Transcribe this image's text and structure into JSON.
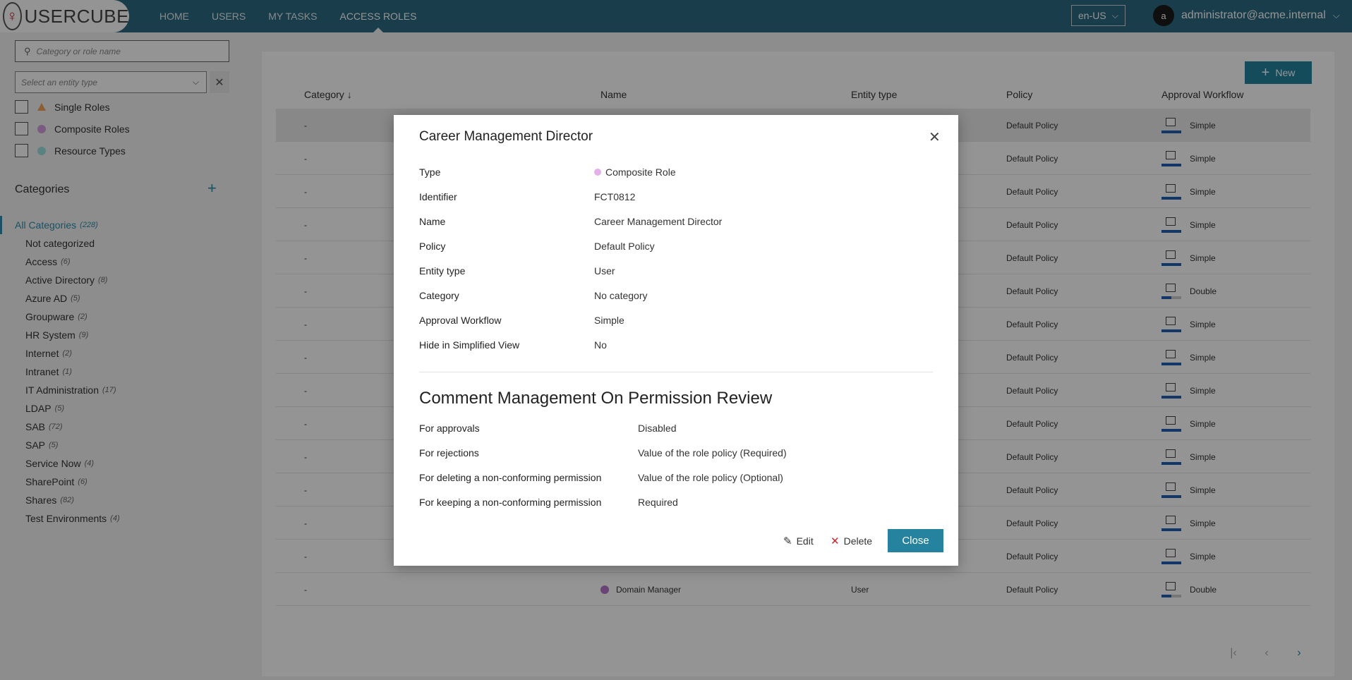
{
  "brand": {
    "name": "USERCUBE"
  },
  "nav": {
    "items": [
      {
        "label": "HOME",
        "active": false
      },
      {
        "label": "USERS",
        "active": false
      },
      {
        "label": "MY TASKS",
        "active": false
      },
      {
        "label": "ACCESS ROLES",
        "active": true
      }
    ],
    "language": "en-US",
    "avatar_initial": "a",
    "user": "administrator@acme.internal"
  },
  "sidebar": {
    "search_placeholder": "Category or role name",
    "entity_placeholder": "Select an entity type",
    "filters": [
      {
        "label": "Single Roles",
        "color": "#f0a35a"
      },
      {
        "label": "Composite Roles",
        "color": "#d69ee0"
      },
      {
        "label": "Resource Types",
        "color": "#9de0e0"
      }
    ],
    "categories_title": "Categories",
    "categories": [
      {
        "label": "All Categories",
        "count": "(228)",
        "active": true
      },
      {
        "label": "Not categorized",
        "count": ""
      },
      {
        "label": "Access",
        "count": "(6)"
      },
      {
        "label": "Active Directory",
        "count": "(8)"
      },
      {
        "label": "Azure AD",
        "count": "(5)"
      },
      {
        "label": "Groupware",
        "count": "(2)"
      },
      {
        "label": "HR System",
        "count": "(9)"
      },
      {
        "label": "Internet",
        "count": "(2)"
      },
      {
        "label": "Intranet",
        "count": "(1)"
      },
      {
        "label": "IT Administration",
        "count": "(17)"
      },
      {
        "label": "LDAP",
        "count": "(5)"
      },
      {
        "label": "SAB",
        "count": "(72)"
      },
      {
        "label": "SAP",
        "count": "(5)"
      },
      {
        "label": "Service Now",
        "count": "(4)"
      },
      {
        "label": "SharePoint",
        "count": "(6)"
      },
      {
        "label": "Shares",
        "count": "(82)"
      },
      {
        "label": "Test Environments",
        "count": "(4)"
      }
    ]
  },
  "table": {
    "new_label": "New",
    "headers": {
      "category": "Category",
      "sort_indicator": "↓",
      "name": "Name",
      "entity_type": "Entity type",
      "policy": "Policy",
      "workflow": "Approval Workflow"
    },
    "rows": [
      {
        "category": "-",
        "name": "",
        "entity": "",
        "policy": "Default Policy",
        "workflow": "Simple",
        "progress": 1.0
      },
      {
        "category": "-",
        "name": "",
        "entity": "",
        "policy": "Default Policy",
        "workflow": "Simple",
        "progress": 1.0
      },
      {
        "category": "-",
        "name": "",
        "entity": "",
        "policy": "Default Policy",
        "workflow": "Simple",
        "progress": 1.0
      },
      {
        "category": "-",
        "name": "",
        "entity": "",
        "policy": "Default Policy",
        "workflow": "Simple",
        "progress": 1.0
      },
      {
        "category": "-",
        "name": "",
        "entity": "",
        "policy": "Default Policy",
        "workflow": "Simple",
        "progress": 1.0
      },
      {
        "category": "-",
        "name": "",
        "entity": "",
        "policy": "Default Policy",
        "workflow": "Double",
        "progress": 0.5
      },
      {
        "category": "-",
        "name": "",
        "entity": "",
        "policy": "Default Policy",
        "workflow": "Simple",
        "progress": 1.0
      },
      {
        "category": "-",
        "name": "",
        "entity": "",
        "policy": "Default Policy",
        "workflow": "Simple",
        "progress": 1.0
      },
      {
        "category": "-",
        "name": "",
        "entity": "",
        "policy": "Default Policy",
        "workflow": "Simple",
        "progress": 1.0
      },
      {
        "category": "-",
        "name": "",
        "entity": "",
        "policy": "Default Policy",
        "workflow": "Simple",
        "progress": 1.0
      },
      {
        "category": "-",
        "name": "",
        "entity": "",
        "policy": "Default Policy",
        "workflow": "Simple",
        "progress": 1.0
      },
      {
        "category": "-",
        "name": "",
        "entity": "",
        "policy": "Default Policy",
        "workflow": "Simple",
        "progress": 1.0
      },
      {
        "category": "-",
        "name": "",
        "entity": "",
        "policy": "Default Policy",
        "workflow": "Simple",
        "progress": 1.0
      },
      {
        "category": "-",
        "name": "",
        "entity": "",
        "policy": "Default Policy",
        "workflow": "Simple",
        "progress": 1.0
      },
      {
        "category": "-",
        "name": "Domain Manager",
        "entity": "User",
        "policy": "Default Policy",
        "workflow": "Double",
        "progress": 0.5
      }
    ]
  },
  "modal": {
    "title": "Career Management Director",
    "fields": [
      {
        "label": "Type",
        "value": "Composite Role"
      },
      {
        "label": "Identifier",
        "value": "FCT0812"
      },
      {
        "label": "Name",
        "value": "Career Management Director"
      },
      {
        "label": "Policy",
        "value": "Default Policy"
      },
      {
        "label": "Entity type",
        "value": "User"
      },
      {
        "label": "Category",
        "value": "No category"
      },
      {
        "label": "Approval Workflow",
        "value": "Simple"
      },
      {
        "label": "Hide in Simplified View",
        "value": "No"
      }
    ],
    "comment_title": "Comment Management On Permission Review",
    "comments": [
      {
        "label": "For approvals",
        "value": "Disabled"
      },
      {
        "label": "For rejections",
        "value": "Value of the role policy (Required)"
      },
      {
        "label": "For deleting a non-conforming permission",
        "value": "Value of the role policy (Optional)"
      },
      {
        "label": "For keeping a non-conforming permission",
        "value": "Required"
      }
    ],
    "edit_label": "Edit",
    "delete_label": "Delete",
    "close_label": "Close"
  },
  "colors": {
    "nav_bg": "#2c6a80",
    "accent": "#25839f",
    "composite_role": "#b676c9"
  }
}
